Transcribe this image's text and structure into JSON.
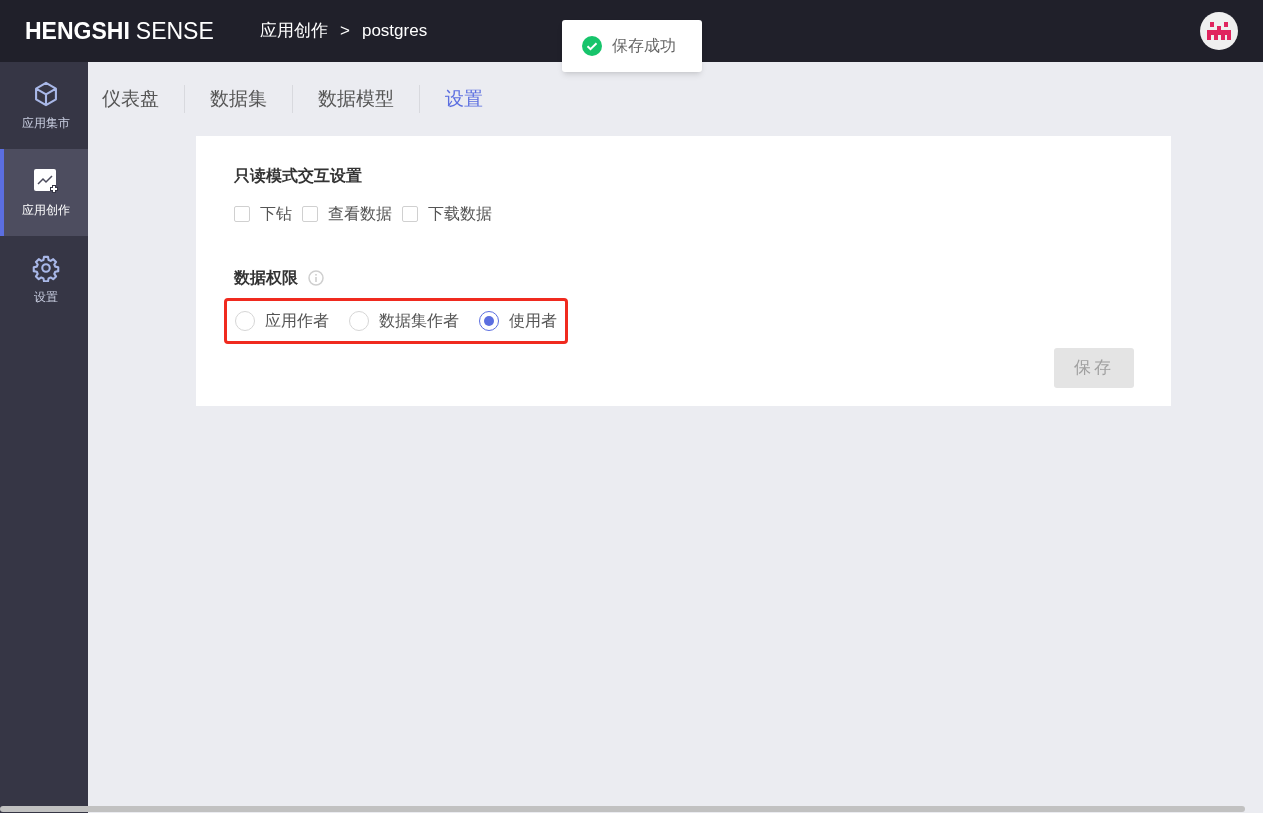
{
  "header": {
    "logo_bold": "HENGSHI",
    "logo_light": "SENSE",
    "breadcrumb": [
      "应用创作",
      "postgres"
    ],
    "breadcrumb_separator": ">"
  },
  "toast": {
    "message": "保存成功"
  },
  "sidebar": {
    "items": [
      {
        "label": "应用集市",
        "kind": "cube",
        "selected": false
      },
      {
        "label": "应用创作",
        "kind": "chart",
        "selected": true
      },
      {
        "label": "设置",
        "kind": "gear",
        "selected": false
      }
    ]
  },
  "tabs": [
    {
      "label": "仪表盘",
      "selected": false
    },
    {
      "label": "数据集",
      "selected": false
    },
    {
      "label": "数据模型",
      "selected": false
    },
    {
      "label": "设置",
      "selected": true
    }
  ],
  "readonly_section": {
    "title": "只读模式交互设置",
    "options": [
      {
        "label": "下钻",
        "checked": false
      },
      {
        "label": "查看数据",
        "checked": false
      },
      {
        "label": "下载数据",
        "checked": false
      }
    ]
  },
  "permission_section": {
    "title": "数据权限",
    "highlighted": true,
    "options": [
      {
        "label": "应用作者",
        "selected": false
      },
      {
        "label": "数据集作者",
        "selected": false
      },
      {
        "label": "使用者",
        "selected": true
      }
    ]
  },
  "save_button": {
    "label": "保存",
    "disabled": true
  }
}
